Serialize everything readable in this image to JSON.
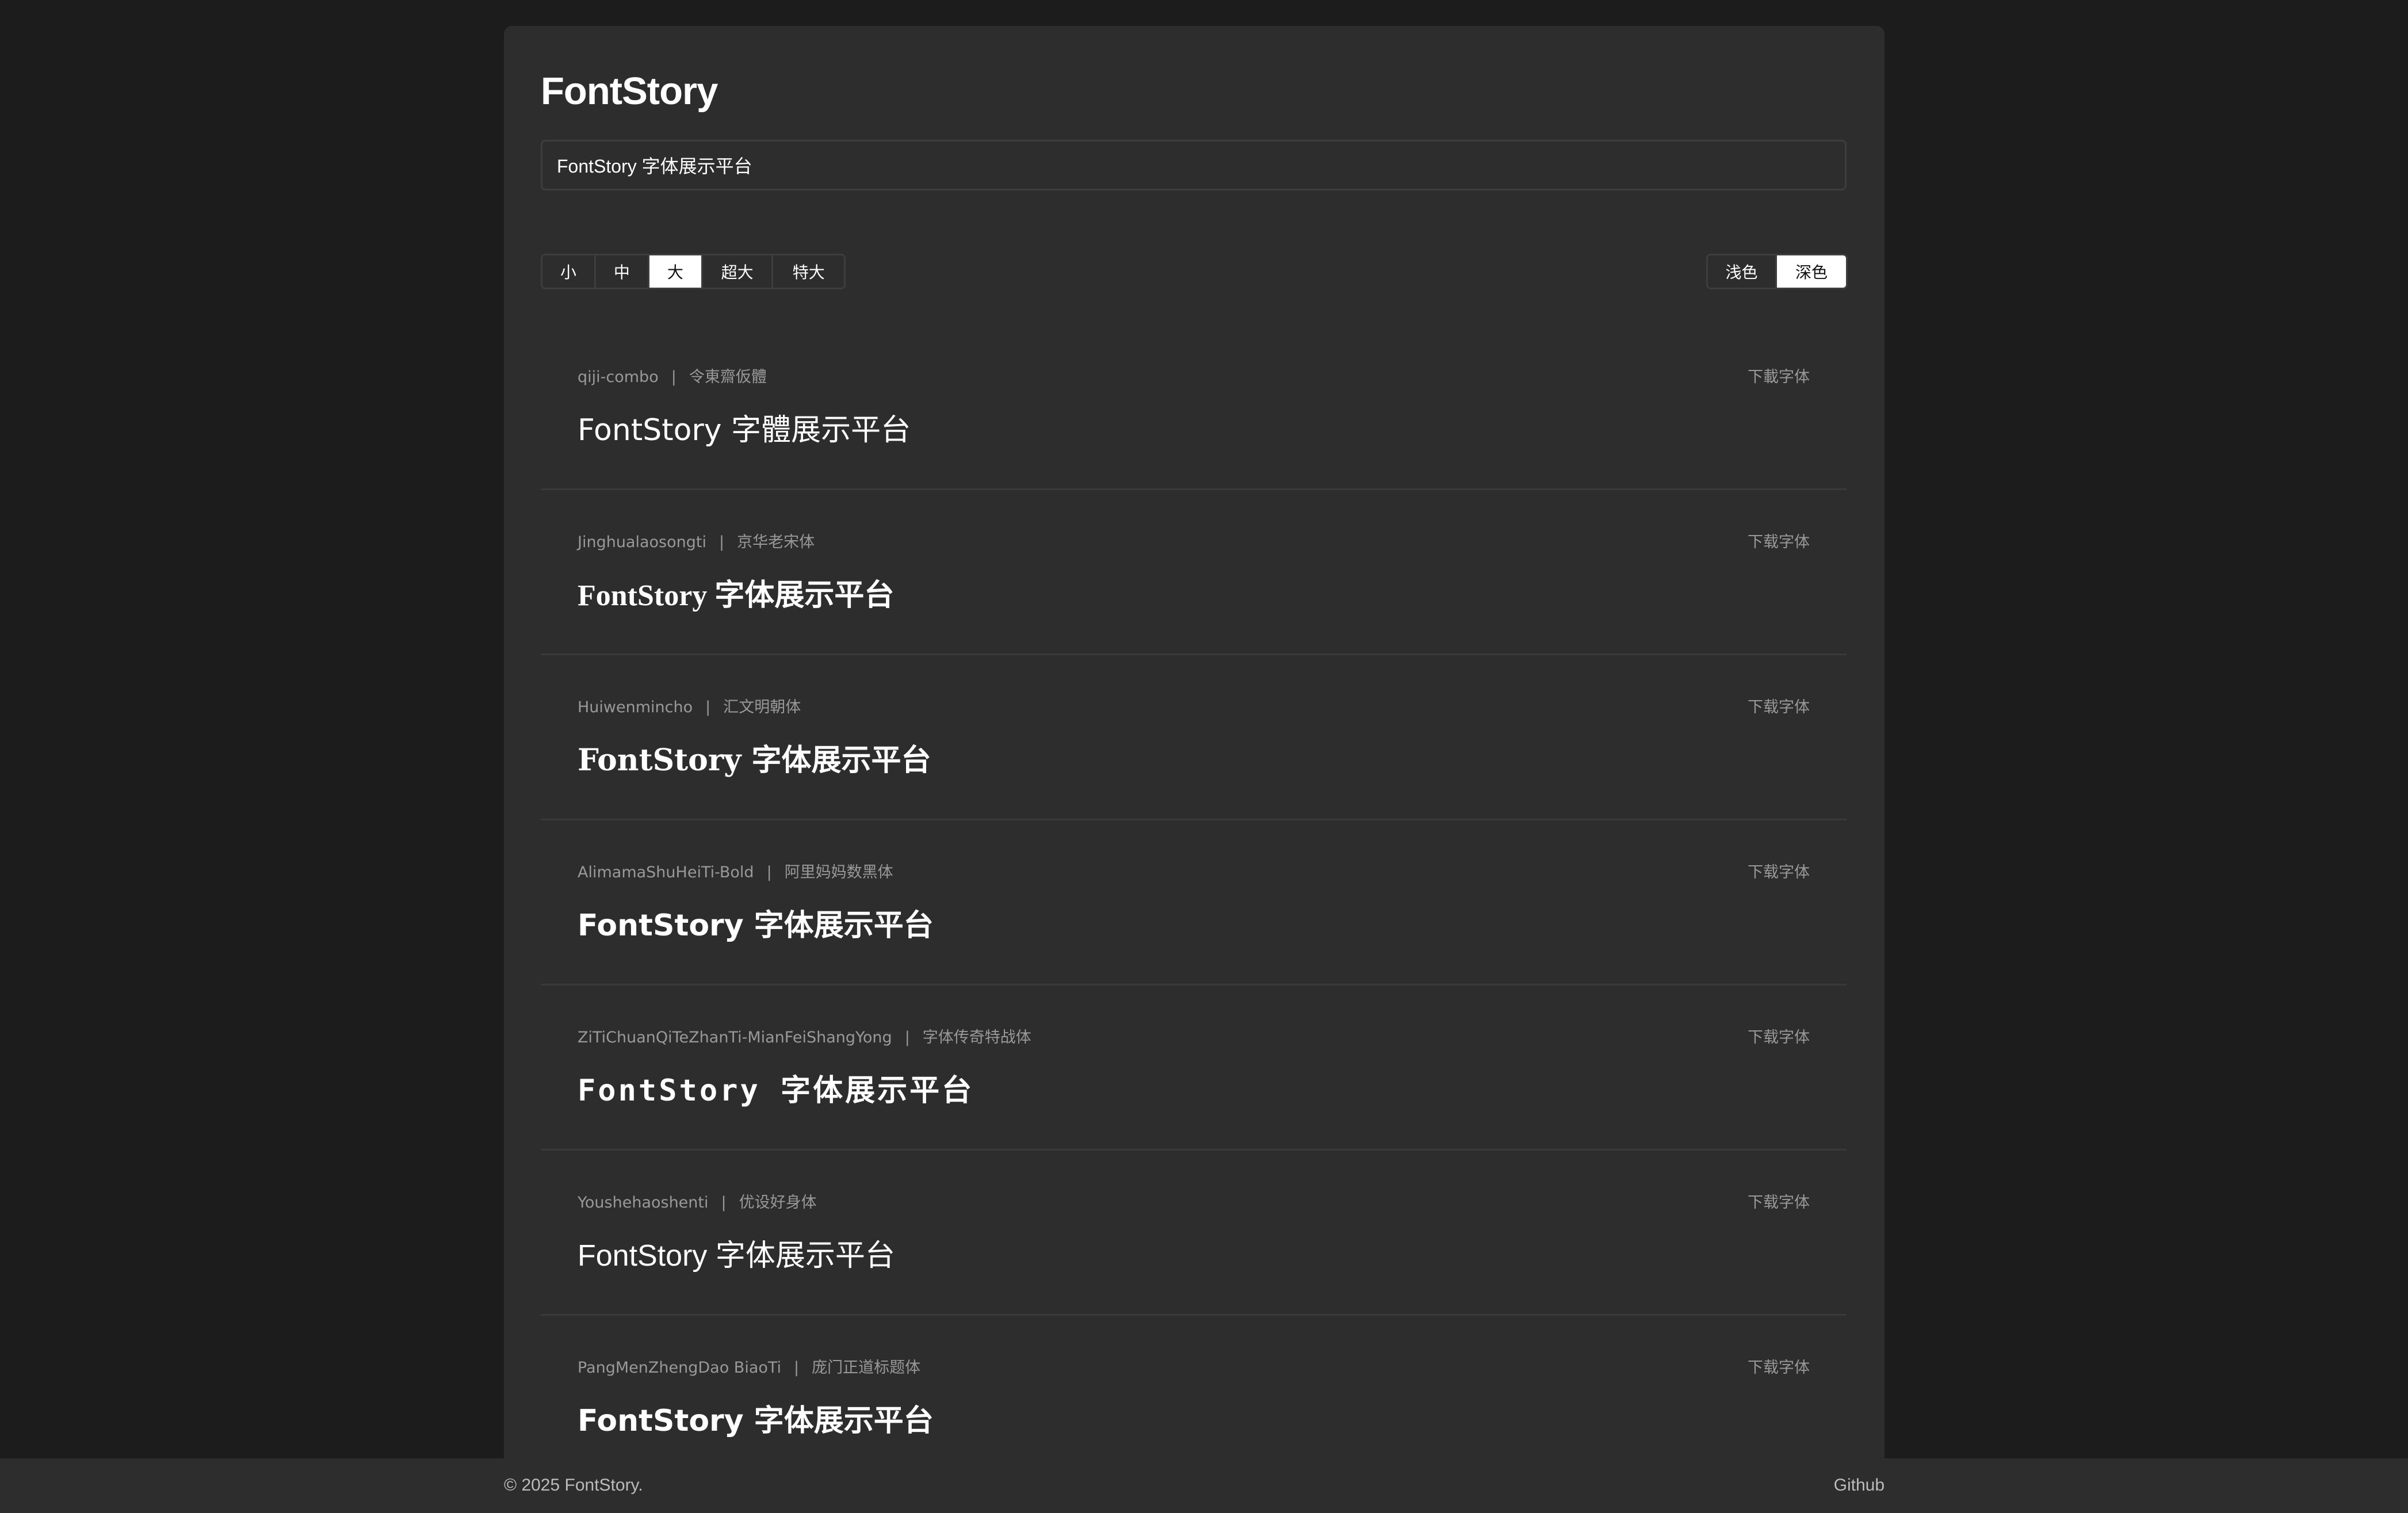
{
  "brand": "FontStory",
  "input": {
    "value": "FontStory 字体展示平台"
  },
  "sizes": [
    {
      "label": "小",
      "active": false
    },
    {
      "label": "中",
      "active": false
    },
    {
      "label": "大",
      "active": true
    },
    {
      "label": "超大",
      "active": false
    },
    {
      "label": "特大",
      "active": false
    }
  ],
  "themes": [
    {
      "label": "浅色",
      "active": false
    },
    {
      "label": "深色",
      "active": true
    }
  ],
  "fonts": [
    {
      "name": "qiji-combo",
      "cn_name": "令東齋仮體",
      "separator": "|",
      "download": "下載字体",
      "preview": "FontStory 字體展示平台"
    },
    {
      "name": "Jinghualaosongti",
      "cn_name": "京华老宋体",
      "separator": "|",
      "download": "下载字体",
      "preview": "FontStory 字体展示平台"
    },
    {
      "name": "Huiwenmincho",
      "cn_name": "汇文明朝体",
      "separator": "|",
      "download": "下载字体",
      "preview": "FontStory 字体展示平台"
    },
    {
      "name": "AlimamaShuHeiTi-Bold",
      "cn_name": "阿里妈妈数黑体",
      "separator": "|",
      "download": "下载字体",
      "preview": "FontStory 字体展示平台"
    },
    {
      "name": "ZiTiChuanQiTeZhanTi-MianFeiShangYong",
      "cn_name": "字体传奇特战体",
      "separator": "|",
      "download": "下载字体",
      "preview": "FontStory 字体展示平台"
    },
    {
      "name": "Youshehaoshenti",
      "cn_name": "优设好身体",
      "separator": "|",
      "download": "下载字体",
      "preview": "FontStory 字体展示平台"
    },
    {
      "name": "PangMenZhengDao BiaoTi",
      "cn_name": "庞门正道标题体",
      "separator": "|",
      "download": "下载字体",
      "preview": "FontStory 字体展示平台"
    }
  ],
  "footer": {
    "copyright": "© 2025 FontStory.",
    "github": "Github"
  }
}
